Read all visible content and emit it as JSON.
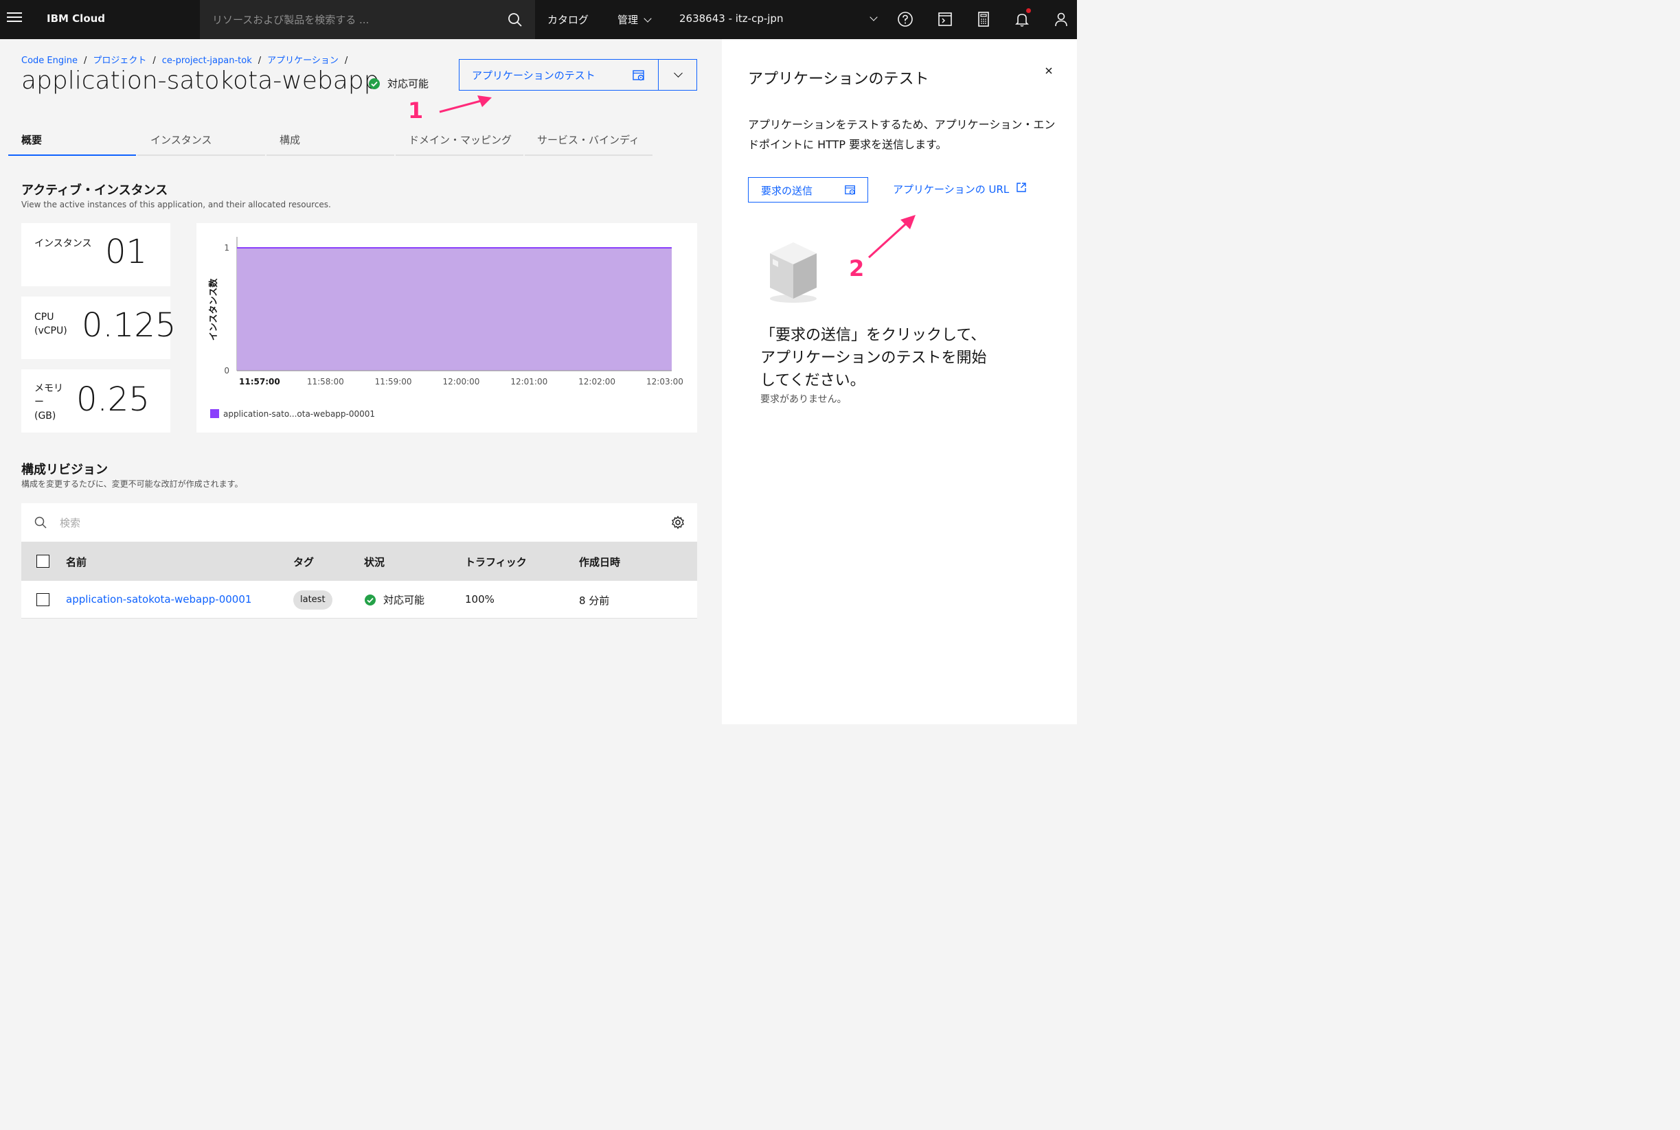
{
  "topbar": {
    "brand": "IBM Cloud",
    "search_placeholder": "リソースおよび製品を検索する ...",
    "catalog": "カタログ",
    "manage": "管理",
    "account": "2638643 - itz-cp-jpn"
  },
  "breadcrumb": [
    "Code Engine",
    "プロジェクト",
    "ce-project-japan-tok",
    "アプリケーション"
  ],
  "header": {
    "title": "application-satokota-webapp",
    "status": "対応可能",
    "test_button": "アプリケーションのテスト"
  },
  "tabs": [
    "概要",
    "インスタンス",
    "構成",
    "ドメイン・マッピング",
    "サービス・バインディ"
  ],
  "active_instances": {
    "title": "アクティブ・インスタンス",
    "description": "View the active instances of this application, and their allocated resources.",
    "stats": [
      {
        "label": "インスタンス",
        "value": "01"
      },
      {
        "label": "CPU (vCPU)",
        "value": "0.125"
      },
      {
        "label": "メモリー (GB)",
        "value": "0.25"
      }
    ]
  },
  "chart_data": {
    "type": "area",
    "x": [
      "11:57:00",
      "11:58:00",
      "11:59:00",
      "12:00:00",
      "12:01:00",
      "12:02:00",
      "12:03:00"
    ],
    "series": [
      {
        "name": "application-sato...ota-webapp-00001",
        "values": [
          1,
          1,
          1,
          1,
          1,
          1,
          1
        ],
        "color": "#8a3ffc"
      }
    ],
    "ylabel": "インスタンス数",
    "yticks": [
      "0",
      "1"
    ],
    "ylim": [
      0,
      1
    ],
    "fill_color": "#c5a8e8",
    "legend": "bottom-left"
  },
  "revisions": {
    "title": "構成リビジョン",
    "description": "構成を変更するたびに、変更不可能な改訂が作成されます。",
    "search_placeholder": "検索",
    "columns": [
      "名前",
      "タグ",
      "状況",
      "トラフィック",
      "作成日時"
    ],
    "rows": [
      {
        "name": "application-satokota-webapp-00001",
        "tag": "latest",
        "status": "対応可能",
        "traffic": "100%",
        "created": "8 分前"
      }
    ]
  },
  "panel": {
    "title": "アプリケーションのテスト",
    "description": "アプリケーションをテストするため、アプリケーション・エンドポイントに HTTP 要求を送信します。",
    "send_button": "要求の送信",
    "url_link": "アプリケーションの URL",
    "empty_title": "「要求の送信」をクリックして、アプリケーションのテストを開始してください。",
    "empty_sub": "要求がありません。"
  },
  "annotations": [
    "1",
    "2"
  ],
  "colors": {
    "accent": "#0f62fe",
    "success": "#24a148",
    "annotation": "#ff2a7a",
    "notification": "#da1e28"
  }
}
